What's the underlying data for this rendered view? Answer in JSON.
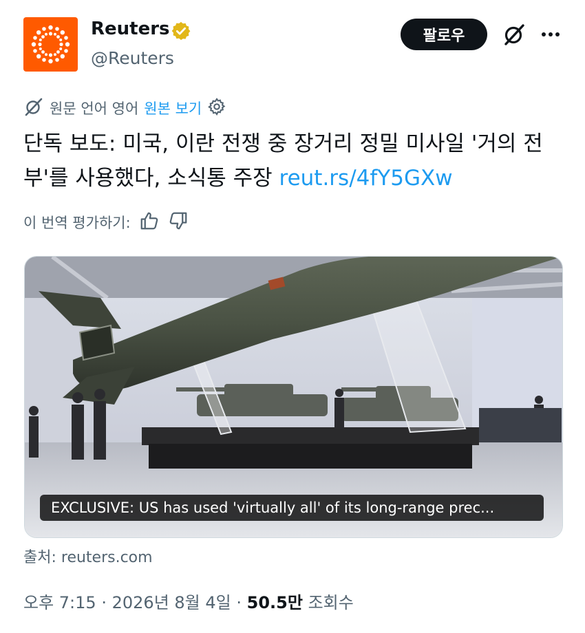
{
  "author": {
    "name": "Reuters",
    "handle": "@Reuters",
    "verified": true,
    "logo_color": "#ff5a00"
  },
  "actions": {
    "follow_label": "팔로우",
    "grok_icon": "grok-icon",
    "more_icon": "more-icon"
  },
  "translation": {
    "note": "원문 언어 영어",
    "show_original": "원본 보기",
    "settings_icon": "gear-icon"
  },
  "tweet": {
    "text": "단독 보도: 미국, 이란 전쟁 중 장거리 정밀 미사일 '거의 전부'를 사용했다, 소식통 주장 ",
    "link": "reut.rs/4fY5GXw"
  },
  "rate": {
    "label": "이 번역 평가하기:",
    "thumbs_up_icon": "thumbs-up-icon",
    "thumbs_down_icon": "thumbs-down-icon"
  },
  "media": {
    "caption": "EXCLUSIVE: US has used 'virtually all' of its long-range prec..."
  },
  "source": "출처: reuters.com",
  "meta": {
    "time": "오후 7:15",
    "date": "2026년 8월 4일",
    "sep": "·",
    "views": "50.5만",
    "views_label": "조회수"
  },
  "colors": {
    "text": "#0f1419",
    "secondary": "#536471",
    "link": "#1d9bf0",
    "follow_bg": "#0f1419"
  }
}
